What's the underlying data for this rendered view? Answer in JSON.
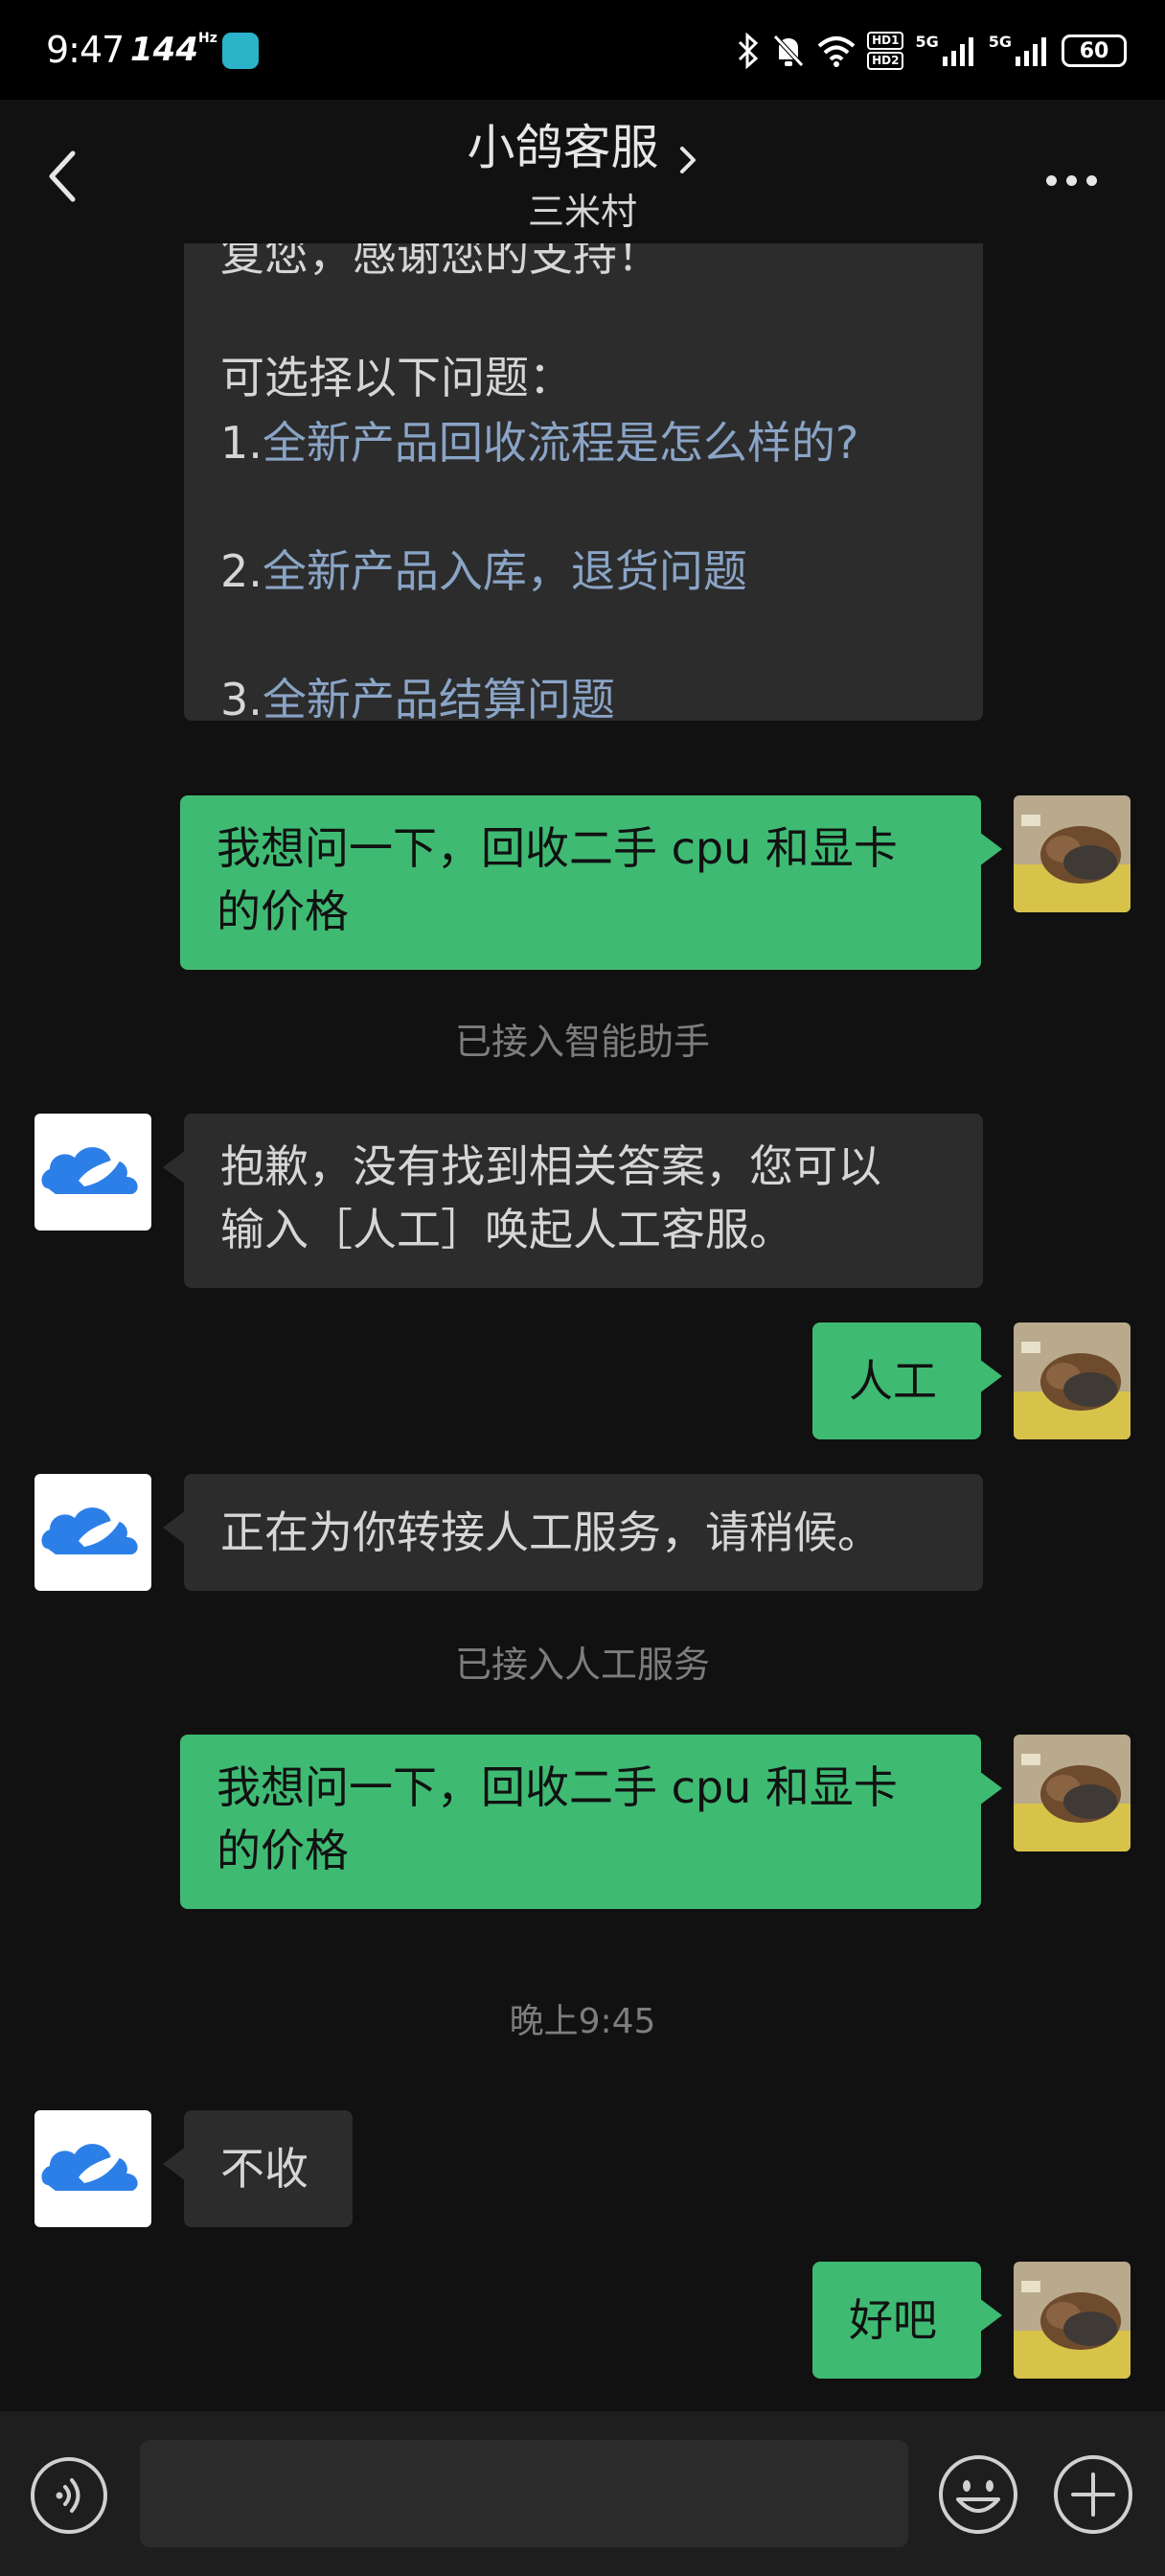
{
  "status_bar": {
    "time": "9:47",
    "refresh_rate": "144",
    "refresh_unit": "Hz",
    "hd1": "HD1",
    "hd2": "HD2",
    "net1": "5G",
    "net2": "5G",
    "battery": "60"
  },
  "header": {
    "title": "小鸽客服",
    "subtitle": "三米村"
  },
  "messages": {
    "m1": {
      "line0": "复您，感谢您的支持！",
      "line1": "可选择以下问题：",
      "q1_num": "1.",
      "q1_link": "全新产品回收流程是怎么样的?",
      "q2_num": "2.",
      "q2_link": "全新产品入库，退货问题",
      "q3_num": "3.",
      "q3_link": "全新产品结算问题"
    },
    "m2": {
      "line1": "我想问一下，回收二手 cpu 和显卡",
      "line2": "的价格"
    },
    "sys1": "已接入智能助手",
    "m3": {
      "line1": "抱歉，没有找到相关答案，您可以",
      "line2": "输入［人工］唤起人工客服。"
    },
    "m4": "人工",
    "m5": "正在为你转接人工服务，请稍候。",
    "sys2": "已接入人工服务",
    "m6": {
      "line1": "我想问一下，回收二手 cpu 和显卡",
      "line2": "的价格"
    },
    "timestamp": "晚上9:45",
    "m7": "不收",
    "m8": "好吧"
  },
  "icons": {
    "back": "chevron-left-icon",
    "title_chevron": "chevron-right-icon",
    "more": "more-dots-icon",
    "voice": "voice-icon",
    "emoji": "emoji-icon",
    "plus": "plus-icon",
    "bot_avatar": "cloud-bird-logo"
  },
  "colors": {
    "background": "#111111",
    "incoming_bubble": "#2c2c2c",
    "outgoing_bubble": "#3fba73",
    "link": "#8aa4c6",
    "bot_logo": "#2d7fe8"
  }
}
